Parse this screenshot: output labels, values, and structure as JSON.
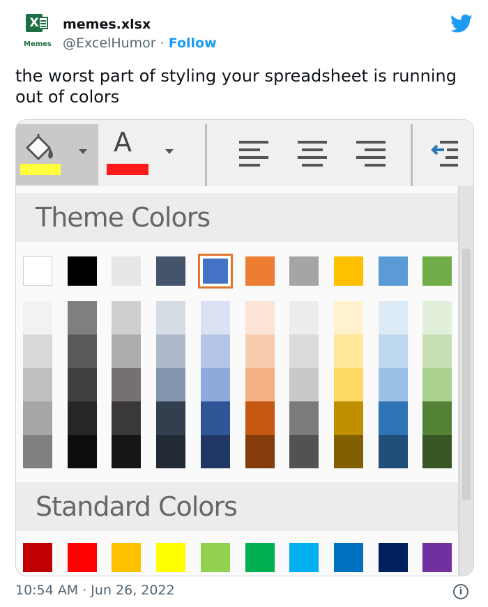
{
  "tweet": {
    "display_name": "memes.xlsx",
    "handle": "@ExcelHumor",
    "separator": "·",
    "follow_label": "Follow",
    "avatar_label": "Memes",
    "avatar_letter": "X",
    "text": "the worst part of styling your spreadsheet is running out of colors",
    "timestamp": "10:54 AM · Jun 26, 2022",
    "info_icon": "i"
  },
  "icons": [
    "excel-logo-icon",
    "twitter-bird-icon",
    "fill-color-icon",
    "font-color-icon",
    "align-left-icon",
    "align-center-icon",
    "align-right-icon",
    "decrease-indent-icon",
    "info-icon"
  ],
  "toolbar": {
    "font_letter": "A",
    "fill_color": "#ffff3b",
    "font_color": "#ff1a1a"
  },
  "palette": {
    "theme_heading": "Theme Colors",
    "standard_heading": "Standard Colors",
    "theme_base": [
      "#ffffff",
      "#000000",
      "#e7e6e6",
      "#44546a",
      "#4472c4",
      "#ed7d31",
      "#a5a5a5",
      "#ffc000",
      "#5b9bd5",
      "#70ad47"
    ],
    "selected_index": 4,
    "theme_shades": [
      [
        "#f2f2f2",
        "#d9d9d9",
        "#bfbfbf",
        "#a6a6a6",
        "#808080"
      ],
      [
        "#7f7f7f",
        "#595959",
        "#404040",
        "#262626",
        "#0d0d0d"
      ],
      [
        "#d0cece",
        "#aeabab",
        "#757171",
        "#3a3838",
        "#171616"
      ],
      [
        "#d6dce4",
        "#adb9ca",
        "#8497b0",
        "#333f4f",
        "#222b35"
      ],
      [
        "#d9e1f2",
        "#b4c6e7",
        "#8ea9db",
        "#2f5597",
        "#203764"
      ],
      [
        "#fce4d6",
        "#f8cbad",
        "#f4b084",
        "#c65911",
        "#843c0c"
      ],
      [
        "#ededed",
        "#dbdbdb",
        "#c9c9c9",
        "#7b7b7b",
        "#525252"
      ],
      [
        "#fff2cc",
        "#ffe699",
        "#ffd966",
        "#bf8f00",
        "#806000"
      ],
      [
        "#ddebf7",
        "#bdd7ee",
        "#9bc2e6",
        "#2f75b5",
        "#1f4e78"
      ],
      [
        "#e2efda",
        "#c6e0b4",
        "#a9d08e",
        "#548235",
        "#375623"
      ]
    ],
    "standard": [
      "#c00000",
      "#ff0000",
      "#ffc000",
      "#ffff00",
      "#92d050",
      "#00b050",
      "#00b0f0",
      "#0070c0",
      "#002060",
      "#7030a0"
    ]
  }
}
